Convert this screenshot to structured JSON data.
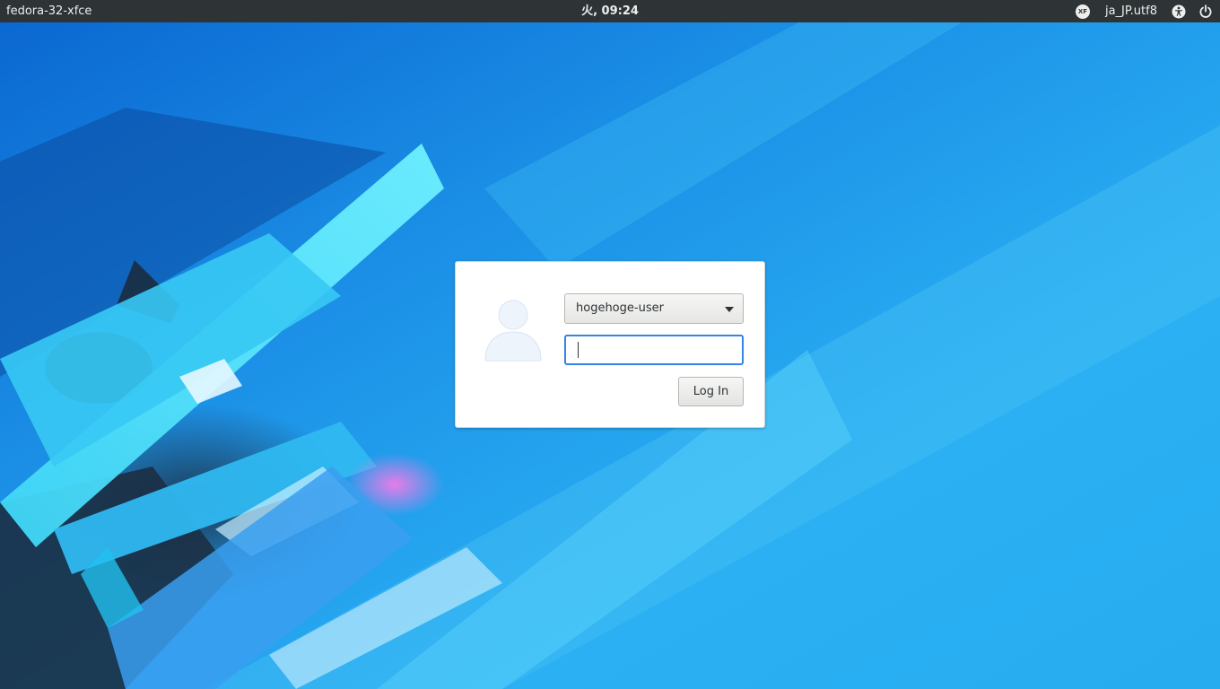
{
  "panel": {
    "hostname": "fedora-32-xfce",
    "clock": "火, 09:24",
    "keyboard_icon_label": "XF",
    "language": "ja_JP.utf8"
  },
  "login": {
    "selected_user": "hogehoge-user",
    "password_value": "",
    "login_button_label": "Log In"
  },
  "icons": {
    "keyboard": "keyboard-layout-icon",
    "accessibility": "accessibility-icon",
    "power": "power-icon",
    "avatar": "user-avatar-icon",
    "dropdown": "chevron-down-icon"
  },
  "colors": {
    "panel_bg": "#2e3436",
    "panel_text": "#eeeeec",
    "focus_accent": "#3584e4",
    "wallpaper_sky": "#29aef2",
    "wallpaper_deep": "#0a72dc"
  }
}
